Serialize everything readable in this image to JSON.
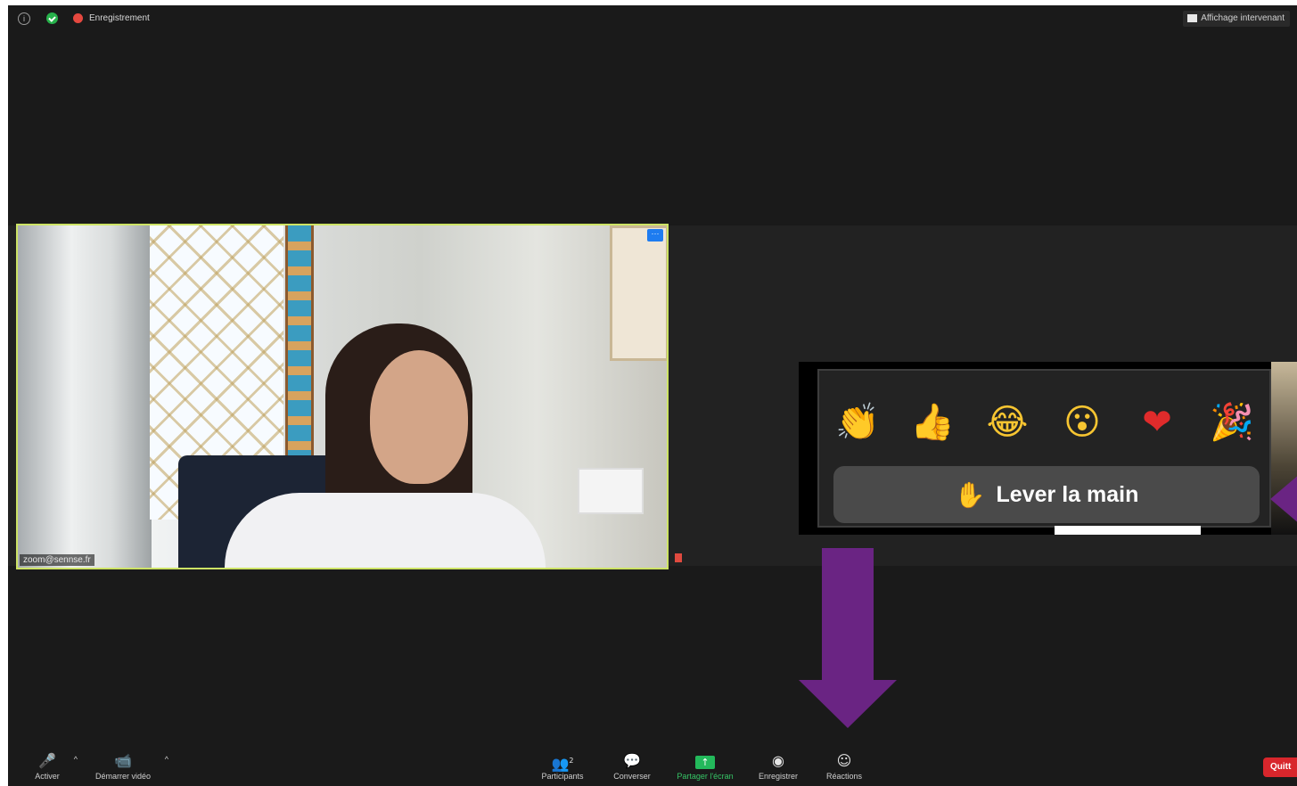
{
  "topbar": {
    "recording_label": "Enregistrement",
    "view_button": "Affichage intervenant"
  },
  "video_tile": {
    "name": "zoom@sennse.fr",
    "menu_glyph": "···"
  },
  "reactions": {
    "emojis": [
      {
        "name": "clap",
        "glyph": "👏"
      },
      {
        "name": "thumbs-up",
        "glyph": "👍"
      },
      {
        "name": "tears-of-joy",
        "glyph": "😂"
      },
      {
        "name": "surprised",
        "glyph": "😮"
      },
      {
        "name": "heart",
        "glyph": "❤"
      },
      {
        "name": "party",
        "glyph": "🎉"
      }
    ],
    "raise_hand_label": "Lever la main",
    "raise_hand_icon": "✋"
  },
  "toolbar": {
    "mute": {
      "label": "Activer",
      "icon": "microphone-off-icon",
      "glyph": "🎤"
    },
    "video": {
      "label": "Démarrer vidéo",
      "icon": "video-off-icon",
      "glyph": "📹"
    },
    "participants": {
      "label": "Participants",
      "icon": "participants-icon",
      "glyph": "👥",
      "count": "2"
    },
    "chat": {
      "label": "Converser",
      "icon": "chat-icon",
      "glyph": "💬"
    },
    "share": {
      "label": "Partager l'écran",
      "icon": "share-screen-icon",
      "glyph": "↑"
    },
    "record": {
      "label": "Enregistrer",
      "icon": "record-icon",
      "glyph": "◉"
    },
    "reactions": {
      "label": "Réactions",
      "icon": "reactions-icon",
      "glyph": "☺"
    },
    "quit": "Quitt"
  },
  "colors": {
    "accent_purple": "#6a2483",
    "share_green": "#23b95b",
    "quit_red": "#d8262c",
    "active_speaker_border": "#cde365"
  }
}
